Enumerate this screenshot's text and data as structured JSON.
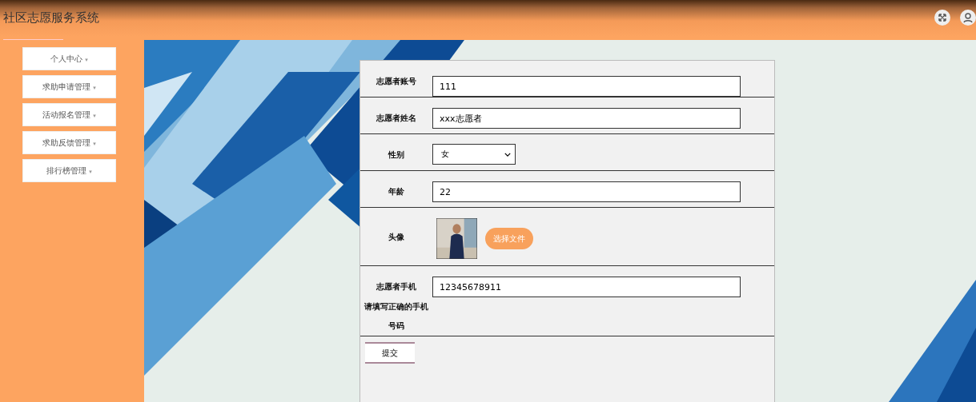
{
  "header": {
    "title": "社区志愿服务系统"
  },
  "sidebar": {
    "items": [
      {
        "label": "个人中心",
        "caret": "▾"
      },
      {
        "label": "求助申请管理",
        "caret": "▾"
      },
      {
        "label": "活动报名管理",
        "caret": "▾"
      },
      {
        "label": "求助反馈管理",
        "caret": "▾"
      },
      {
        "label": "排行榜管理",
        "caret": "▾"
      }
    ]
  },
  "form": {
    "fields": [
      {
        "kind": "text",
        "label": "志愿者账号",
        "value": "111"
      },
      {
        "kind": "text",
        "label": "志愿者姓名",
        "value": "xxx志愿者"
      },
      {
        "kind": "select",
        "label": "性别",
        "value": "女"
      },
      {
        "kind": "text",
        "label": "年龄",
        "value": "22"
      },
      {
        "label": "头像",
        "button": "选择文件"
      },
      {
        "kind": "text",
        "label": "志愿者手机",
        "value": "12345678911",
        "hint": "请填写正确的手机号码"
      }
    ],
    "submit": "提交"
  }
}
